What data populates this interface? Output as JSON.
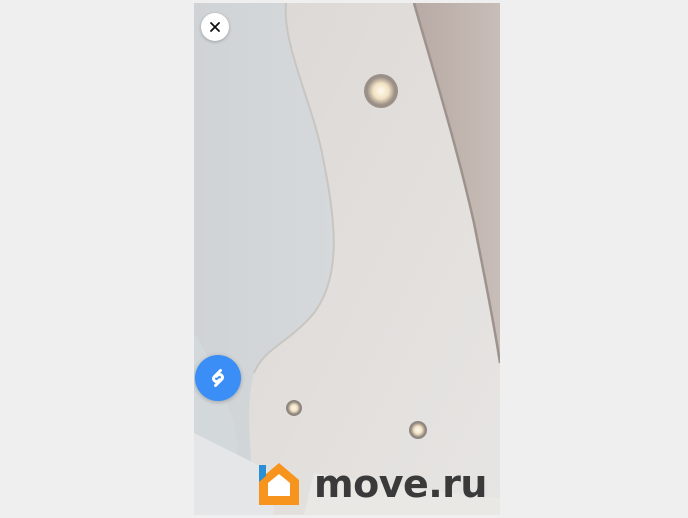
{
  "viewer": {
    "close_icon": "close-icon",
    "shazam_icon": "shazam-icon",
    "accent_color": "#3a8ef6",
    "background_color": "#efefef"
  },
  "watermark": {
    "brand_text": "move.ru",
    "logo_icon": "house-logo-icon",
    "logo_colors": [
      "#f7941d",
      "#2b8fd6"
    ]
  }
}
